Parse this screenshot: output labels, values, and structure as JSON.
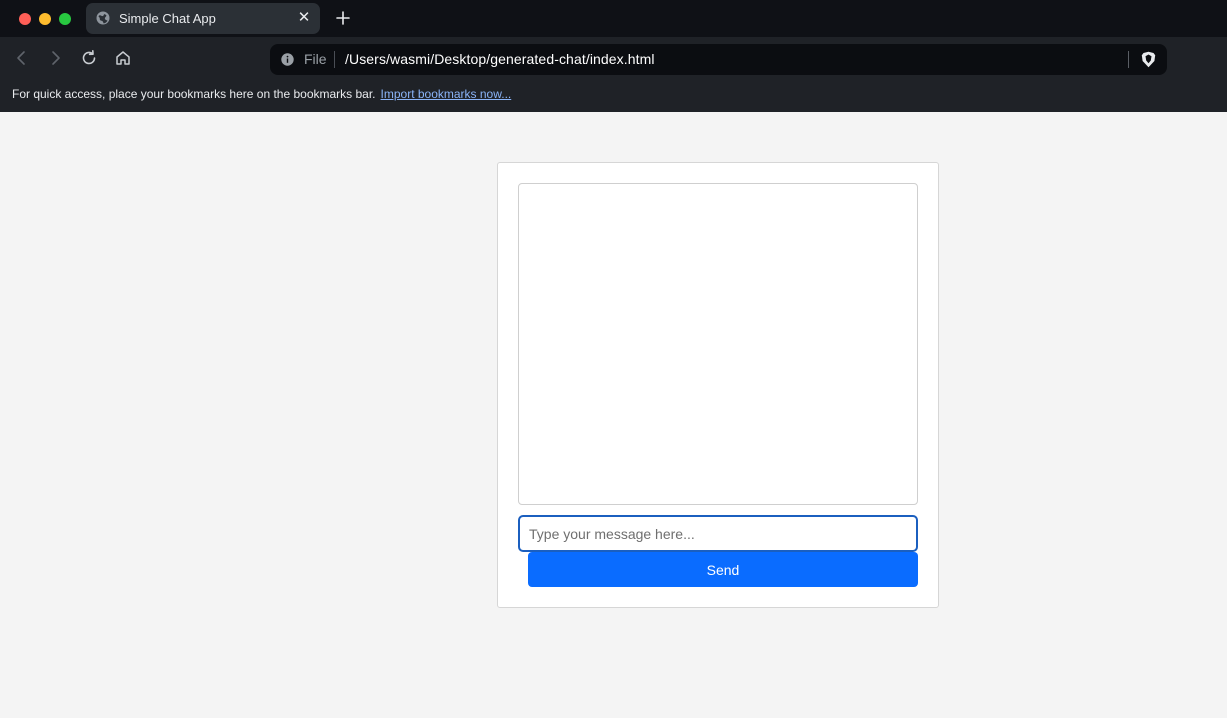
{
  "window": {
    "tab_title": "Simple Chat App",
    "tab_icon": "globe-icon",
    "close_glyph": "✕"
  },
  "toolbar": {
    "omnibox": {
      "scheme_label": "File",
      "url": "/Users/wasmi/Desktop/generated-chat/index.html"
    }
  },
  "bookmarks_bar": {
    "message": "For quick access, place your bookmarks here on the bookmarks bar.",
    "import_link": "Import bookmarks now..."
  },
  "chat": {
    "input_placeholder": "Type your message here...",
    "input_value": "",
    "send_label": "Send",
    "messages": []
  },
  "colors": {
    "accent": "#0a6cff",
    "input_focus": "#1b5fbf",
    "page_bg": "#f4f4f4",
    "link": "#8ab4f8"
  }
}
